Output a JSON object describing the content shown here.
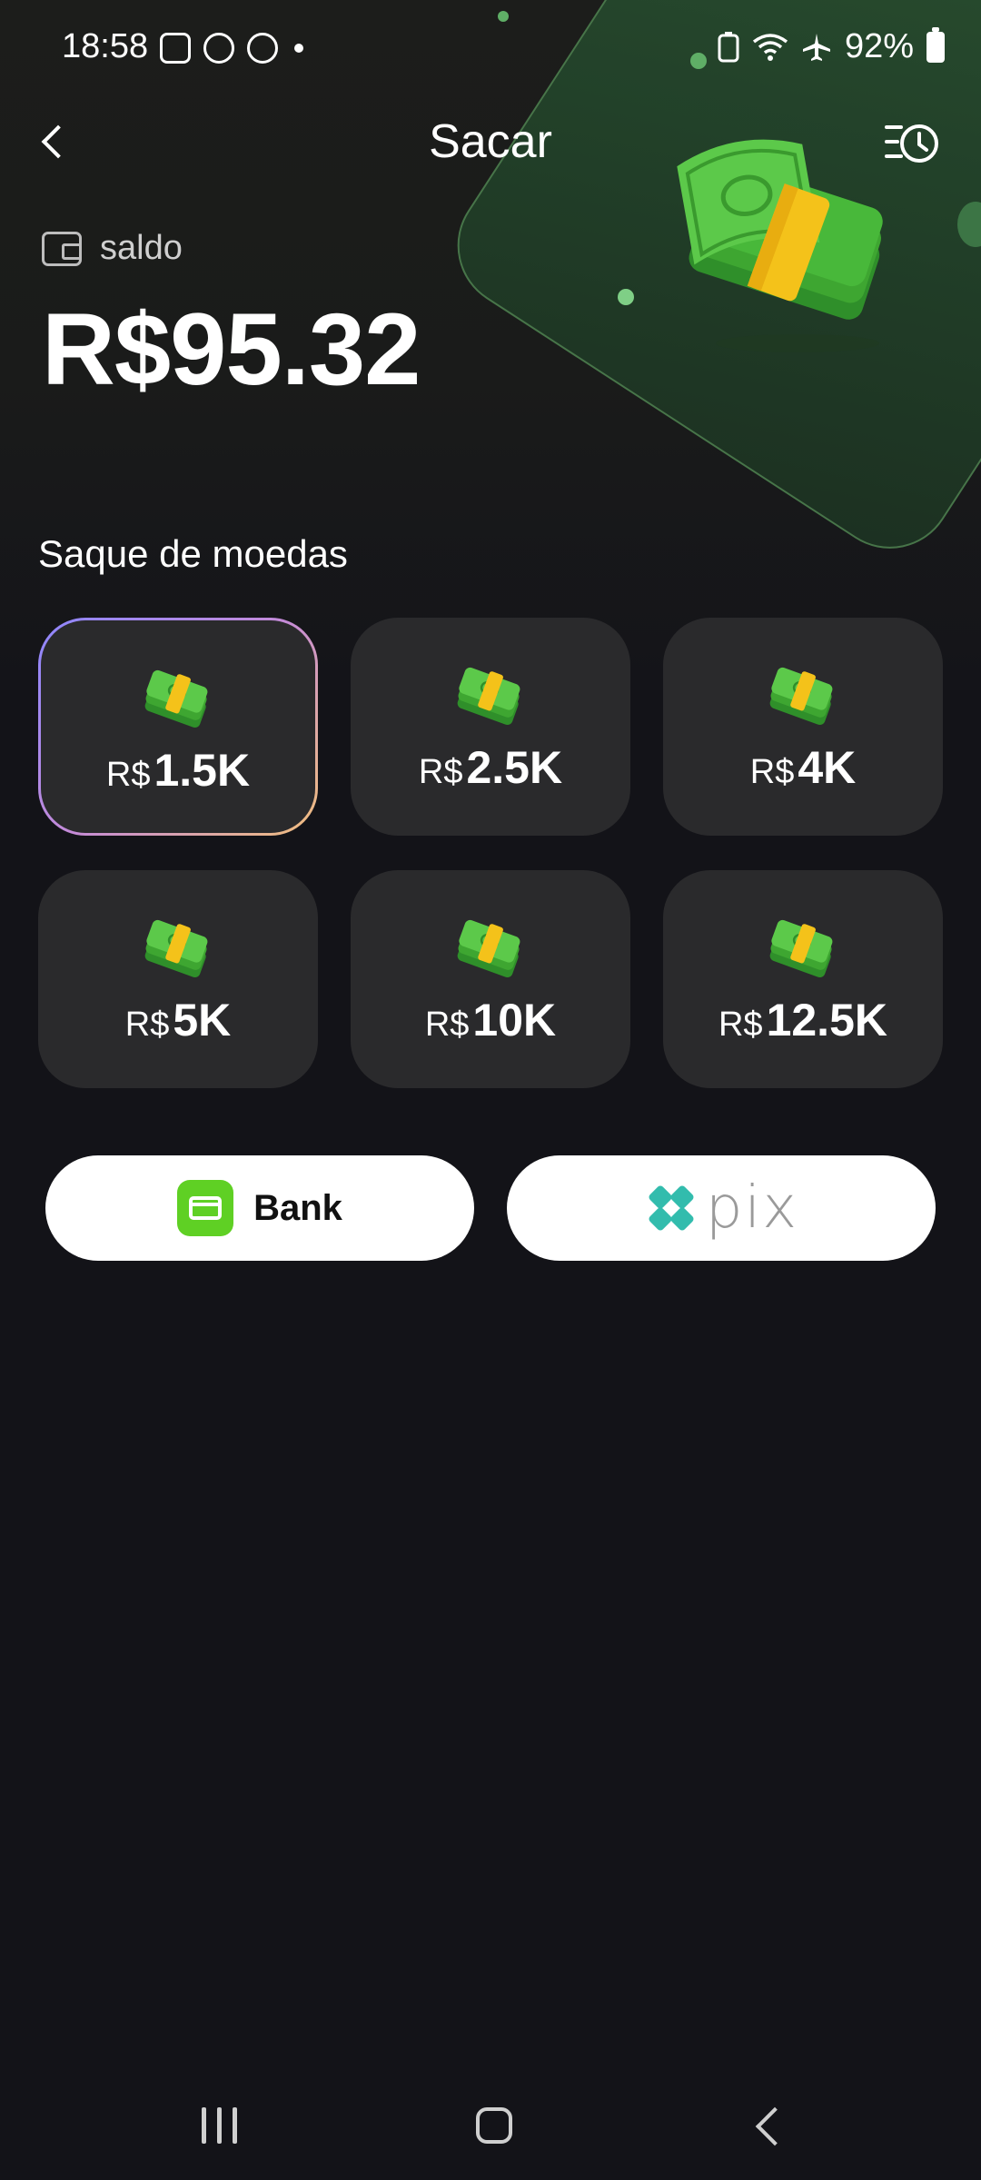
{
  "status_bar": {
    "time": "18:58",
    "battery": "92%",
    "icons": [
      "gallery-icon",
      "heart-circle-icon",
      "phone-circle-icon",
      "dot-icon",
      "battery-saver-icon",
      "wifi-icon",
      "airplane-icon",
      "battery-icon"
    ]
  },
  "header": {
    "title": "Sacar",
    "back_icon": "chevron-left-icon",
    "history_icon": "history-icon"
  },
  "balance": {
    "label": "saldo",
    "value": "R$95.32",
    "icon": "wallet-icon"
  },
  "section": {
    "title": "Saque de moedas"
  },
  "options": [
    {
      "currency": "R$",
      "amount": "1.5K",
      "selected": true
    },
    {
      "currency": "R$",
      "amount": "2.5K",
      "selected": false
    },
    {
      "currency": "R$",
      "amount": "4K",
      "selected": false
    },
    {
      "currency": "R$",
      "amount": "5K",
      "selected": false
    },
    {
      "currency": "R$",
      "amount": "10K",
      "selected": false
    },
    {
      "currency": "R$",
      "amount": "12.5K",
      "selected": false
    }
  ],
  "payment": {
    "bank_label": "Bank",
    "pix_label": "pix"
  },
  "colors": {
    "background": "#131318",
    "tile": "#2a2a2c",
    "accent_green": "#5fd024",
    "hero_green": "#2e5a34"
  }
}
